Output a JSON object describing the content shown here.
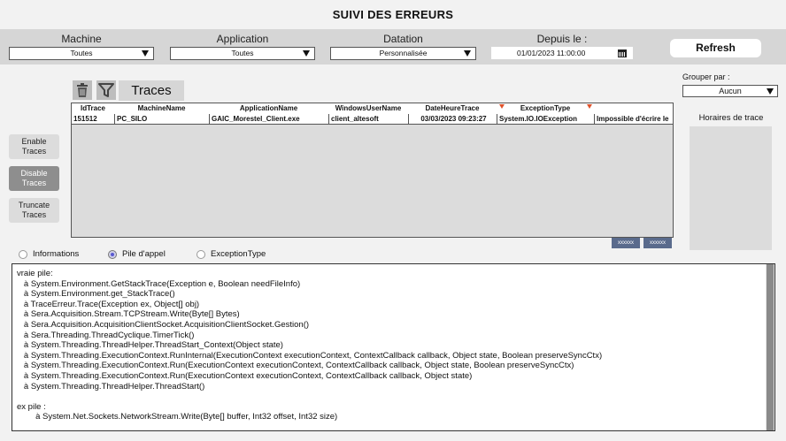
{
  "title": "SUIVI DES ERREURS",
  "filters": {
    "machine": {
      "label": "Machine",
      "value": "Toutes"
    },
    "application": {
      "label": "Application",
      "value": "Toutes"
    },
    "datation": {
      "label": "Datation",
      "value": "Personnalisée"
    },
    "depuis": {
      "label": "Depuis le :",
      "value": "01/01/2023 11:00:00"
    },
    "refresh_label": "Refresh"
  },
  "side_buttons": {
    "enable": "Enable\nTraces",
    "disable": "Disable\nTraces",
    "truncate": "Truncate\nTraces"
  },
  "traces_tab": "Traces",
  "grid": {
    "columns": [
      "IdTrace",
      "MachineName",
      "ApplicationName",
      "WindowsUserName",
      "DateHeureTrace",
      "ExceptionType"
    ],
    "row": [
      "151512",
      "PC_SILO",
      "GAIC_Morestel_Client.exe",
      "client_altesoft",
      "03/03/2023 09:23:27",
      "System.IO.IOException",
      "Impossible d'écrire le"
    ],
    "pager": [
      "xxxxxx",
      "xxxxxx"
    ]
  },
  "right_panel": {
    "group_label": "Grouper par :",
    "group_value": "Aucun",
    "horaires_label": "Horaires de trace"
  },
  "radios": {
    "informations": "Informations",
    "pile": "Pile d'appel",
    "exception": "ExceptionType"
  },
  "stack_text": "vraie pile:\n   à System.Environment.GetStackTrace(Exception e, Boolean needFileInfo)\n   à System.Environment.get_StackTrace()\n   à TraceErreur.Trace(Exception ex, Object[] obj)\n   à Sera.Acquisition.Stream.TCPStream.Write(Byte[] Bytes)\n   à Sera.Acquisition.AcquisitionClientSocket.AcquisitionClientSocket.Gestion()\n   à Sera.Threading.ThreadCyclique.TimerTick()\n   à System.Threading.ThreadHelper.ThreadStart_Context(Object state)\n   à System.Threading.ExecutionContext.RunInternal(ExecutionContext executionContext, ContextCallback callback, Object state, Boolean preserveSyncCtx)\n   à System.Threading.ExecutionContext.Run(ExecutionContext executionContext, ContextCallback callback, Object state, Boolean preserveSyncCtx)\n   à System.Threading.ExecutionContext.Run(ExecutionContext executionContext, ContextCallback callback, Object state)\n   à System.Threading.ThreadHelper.ThreadStart()\n\nex pile :\n        à System.Net.Sockets.NetworkStream.Write(Byte[] buffer, Int32 offset, Int32 size)"
}
